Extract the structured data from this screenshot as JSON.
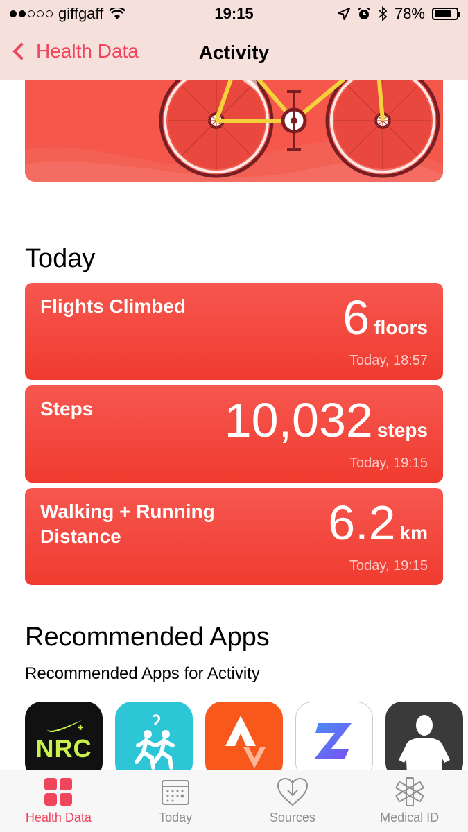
{
  "status_bar": {
    "carrier": "giffgaff",
    "time": "19:15",
    "battery": "78%",
    "battery_level": 0.78,
    "signal_bars_filled": 2,
    "signal_bars_total": 5
  },
  "nav": {
    "back_label": "Health Data",
    "title": "Activity"
  },
  "today": {
    "title": "Today",
    "cards": [
      {
        "label": "Flights Climbed",
        "value": "6",
        "unit": "floors",
        "time": "Today, 18:57"
      },
      {
        "label": "Steps",
        "value": "10,032",
        "unit": "steps",
        "time": "Today, 19:15"
      },
      {
        "label": "Walking + Running Distance",
        "value": "6.2",
        "unit": "km",
        "time": "Today, 19:15"
      }
    ]
  },
  "recommended": {
    "title": "Recommended Apps",
    "subtitle": "Recommended Apps for Activity",
    "apps": [
      {
        "name": "nrc",
        "text": "NRC"
      },
      {
        "name": "runkeeper"
      },
      {
        "name": "strava"
      },
      {
        "name": "zova"
      },
      {
        "name": "fitness"
      }
    ]
  },
  "tab_bar": {
    "tabs": [
      {
        "label": "Health Data",
        "icon": "health-data-icon",
        "active": true
      },
      {
        "label": "Today",
        "icon": "calendar-icon",
        "active": false
      },
      {
        "label": "Sources",
        "icon": "sources-heart-icon",
        "active": false
      },
      {
        "label": "Medical ID",
        "icon": "medical-star-icon",
        "active": false
      }
    ]
  },
  "colors": {
    "accent": "#f0465d",
    "card": "#f5453b",
    "bar_bg": "#f6e0dc"
  }
}
